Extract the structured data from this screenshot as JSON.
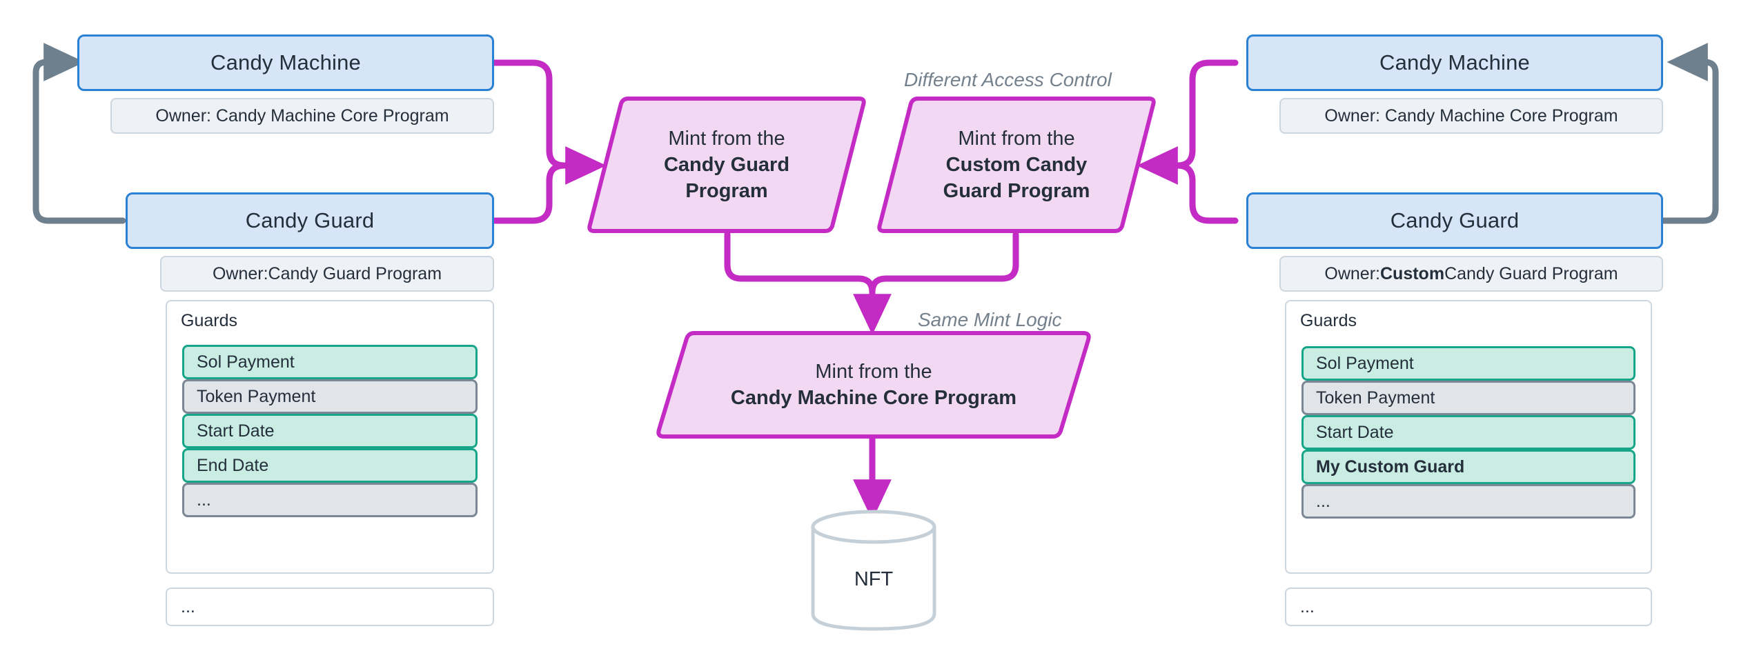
{
  "diagram": {
    "title": "Candy Machine and Candy Guard mint routing",
    "colors": {
      "account_border": "#2a80d2",
      "account_fill": "#d6e6f8",
      "sub_fill": "#eef2f6",
      "sub_border": "#cdd6de",
      "guard_on_fill": "#c9ece3",
      "guard_on_border": "#17a589",
      "guard_off_fill": "#e1e4e8",
      "guard_off_border": "#7b8794",
      "flow_magenta": "#c42bc4",
      "wire_gray": "#6e7f8d",
      "note_gray": "#74818d",
      "text_dark": "#242f3b"
    }
  },
  "left_panel": {
    "candy_machine": {
      "title": "Candy Machine",
      "owner": "Owner: Candy Machine Core Program"
    },
    "candy_guard": {
      "title": "Candy Guard",
      "owner_prefix": "Owner: ",
      "owner_bold": "",
      "owner_suffix": "Candy Guard Program",
      "guards_label": "Guards",
      "guards": [
        {
          "label": "Sol Payment",
          "enabled": true,
          "bold": false
        },
        {
          "label": "Token Payment",
          "enabled": false,
          "bold": false
        },
        {
          "label": "Start Date",
          "enabled": true,
          "bold": false
        },
        {
          "label": "End Date",
          "enabled": true,
          "bold": false
        },
        {
          "label": "...",
          "enabled": false,
          "bold": false
        }
      ],
      "footer": "..."
    }
  },
  "right_panel": {
    "candy_machine": {
      "title": "Candy Machine",
      "owner": "Owner: Candy Machine Core Program"
    },
    "candy_guard": {
      "title": "Candy Guard",
      "owner_prefix": "Owner: ",
      "owner_bold": "Custom",
      "owner_suffix": " Candy Guard Program",
      "guards_label": "Guards",
      "guards": [
        {
          "label": "Sol Payment",
          "enabled": true,
          "bold": false
        },
        {
          "label": "Token Payment",
          "enabled": false,
          "bold": false
        },
        {
          "label": "Start Date",
          "enabled": true,
          "bold": false
        },
        {
          "label": "My Custom Guard",
          "enabled": true,
          "bold": true
        },
        {
          "label": "...",
          "enabled": false,
          "bold": false
        }
      ],
      "footer": "..."
    }
  },
  "flow": {
    "mint_candy_guard": {
      "line1": "Mint from the",
      "line2": "Candy Guard",
      "line3": "Program"
    },
    "mint_custom_candy_guard": {
      "line1": "Mint from the",
      "line2": "Custom Candy",
      "line3": "Guard Program"
    },
    "mint_core": {
      "line1": "Mint from the",
      "line2": "Candy Machine Core Program"
    },
    "note_access_control": "Different Access Control",
    "note_mint_logic": "Same Mint Logic",
    "nft_label": "NFT"
  }
}
